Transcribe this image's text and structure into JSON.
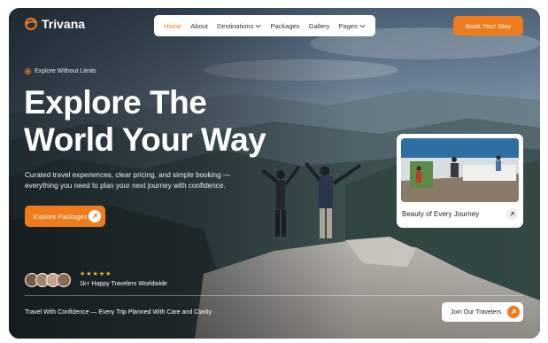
{
  "brand": {
    "name": "Trivana"
  },
  "nav": {
    "items": [
      {
        "label": "Home",
        "active": true,
        "dropdown": false
      },
      {
        "label": "About",
        "active": false,
        "dropdown": false
      },
      {
        "label": "Destinations",
        "active": false,
        "dropdown": true
      },
      {
        "label": "Packages",
        "active": false,
        "dropdown": false
      },
      {
        "label": "Gallery",
        "active": false,
        "dropdown": false
      },
      {
        "label": "Pages",
        "active": false,
        "dropdown": true
      }
    ],
    "cta": "Book Your Stay"
  },
  "hero": {
    "tagline": "Explore Without Limits",
    "headline_1": "Explore The",
    "headline_2": "World Your Way",
    "subtitle": "Curated travel experiences, clear pricing, and simple booking — everything you need to plan your next journey with confidence.",
    "cta": "Explore Packages"
  },
  "social_proof": {
    "rating": 5,
    "stars_text": "★★★★★",
    "text": "1k+ Happy Travelers Worldwide"
  },
  "footer": {
    "text": "Travel With Confidence — Every Trip Planned With Care and Clarity",
    "cta": "Join Our Travelers"
  },
  "card": {
    "title": "Beauty of Every Journey"
  },
  "colors": {
    "accent": "#f07b1d",
    "star": "#f5b92a"
  }
}
